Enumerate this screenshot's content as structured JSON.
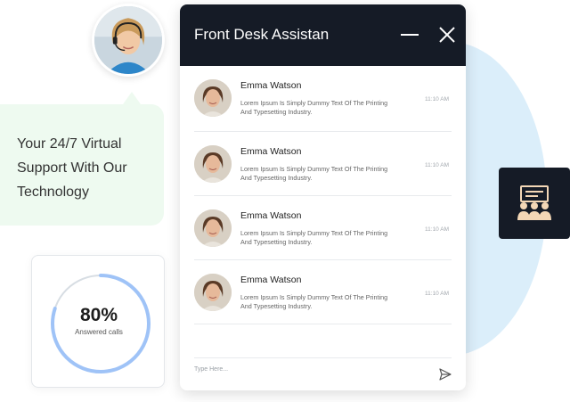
{
  "agent_avatar": {
    "icon": "support-agent-avatar-icon"
  },
  "tagline": {
    "text": "Your 24/7 Virtual Support With Our Technology"
  },
  "stats": {
    "value": "80%",
    "label": "Answered calls",
    "progress": 0.8,
    "ring_color": "#9fc3f7",
    "track_color": "#d7dde3"
  },
  "chat": {
    "title": "Front Desk Assistan",
    "minimize_icon": "minimize-icon",
    "close_icon": "close-icon",
    "items": [
      {
        "name": "Emma Watson",
        "message": "Lorem Ipsum Is Simply Dummy Text Of The Printing And Typesetting Industry.",
        "time": "11:10 AM"
      },
      {
        "name": "Emma Watson",
        "message": "Lorem Ipsum Is Simply Dummy Text Of The Printing And Typesetting Industry.",
        "time": "11:10 AM"
      },
      {
        "name": "Emma Watson",
        "message": "Lorem Ipsum Is Simply Dummy Text Of The Printing And Typesetting Industry.",
        "time": "11:10 AM"
      },
      {
        "name": "Emma Watson",
        "message": "Lorem Ipsum Is Simply Dummy Text Of The Printing And Typesetting Industry.",
        "time": "11:10 AM"
      }
    ],
    "input": {
      "placeholder": "Type Here..."
    },
    "send_icon": "send-icon"
  },
  "side_tile": {
    "icon": "group-meeting-icon"
  },
  "colors": {
    "header_bg": "#151b26",
    "accent_blue": "#dbeefa",
    "bubble_green": "#eefaf0"
  }
}
